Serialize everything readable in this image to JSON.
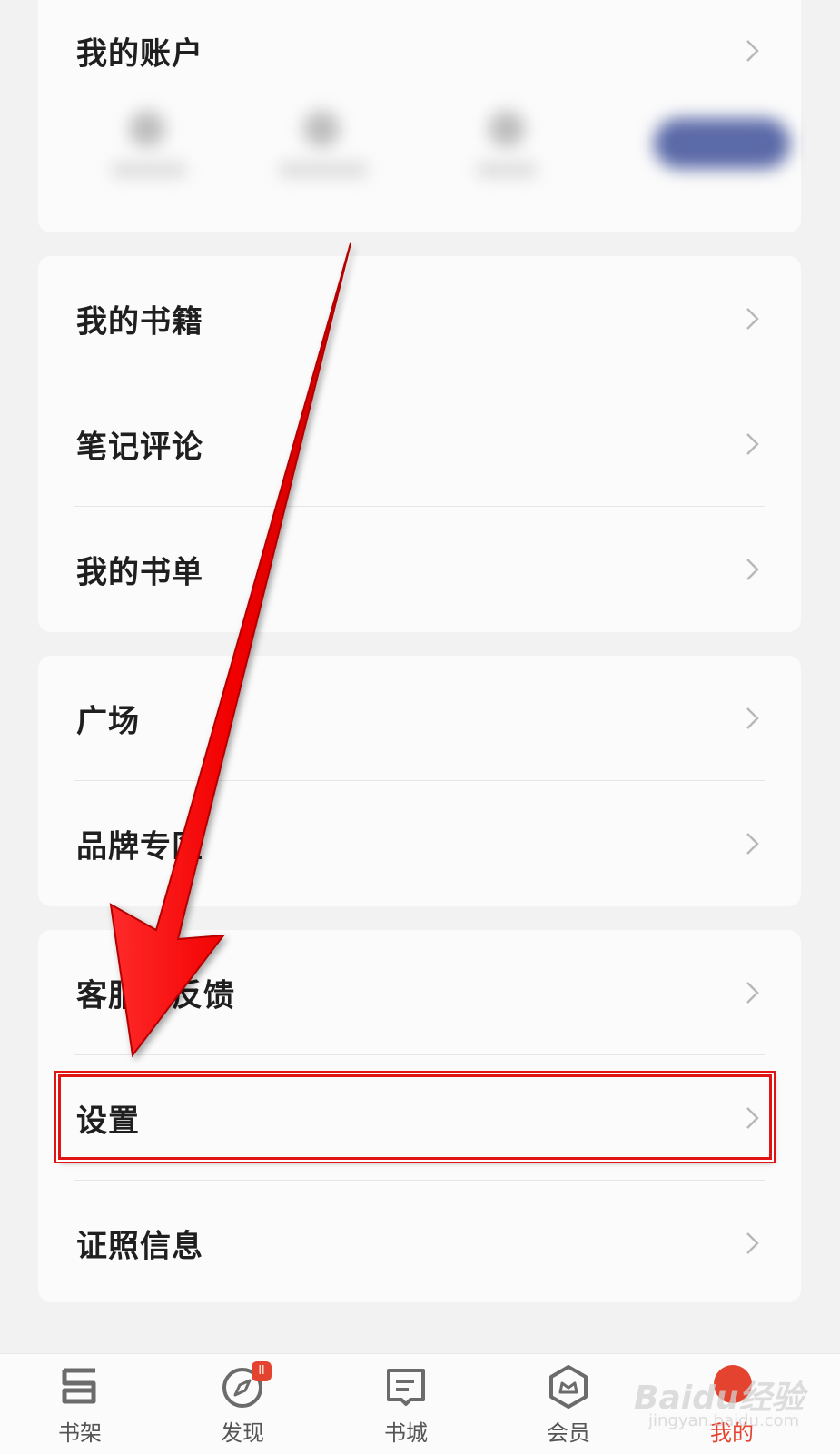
{
  "account_card": {
    "title": "我的账户"
  },
  "reading_card": {
    "items": [
      {
        "label": "我的书籍"
      },
      {
        "label": "笔记评论"
      },
      {
        "label": "我的书单"
      }
    ]
  },
  "community_card": {
    "items": [
      {
        "label": "广场"
      },
      {
        "label": "品牌专区"
      }
    ]
  },
  "service_card": {
    "items": [
      {
        "label": "客服与反馈"
      },
      {
        "label": "设置"
      },
      {
        "label": "证照信息"
      }
    ]
  },
  "tabbar": {
    "tabs": [
      {
        "label": "书架",
        "icon": "bookshelf-icon"
      },
      {
        "label": "发现",
        "icon": "compass-icon",
        "badge": "ll"
      },
      {
        "label": "书城",
        "icon": "bookstore-icon"
      },
      {
        "label": "会员",
        "icon": "member-icon"
      },
      {
        "label": "我的",
        "icon": "profile-icon",
        "active": true
      }
    ]
  },
  "watermark": {
    "main": "Baidu经验",
    "sub": "jingyan.baidu.com"
  },
  "colors": {
    "accent": "#e4432f",
    "annotation_red": "#e11414"
  }
}
